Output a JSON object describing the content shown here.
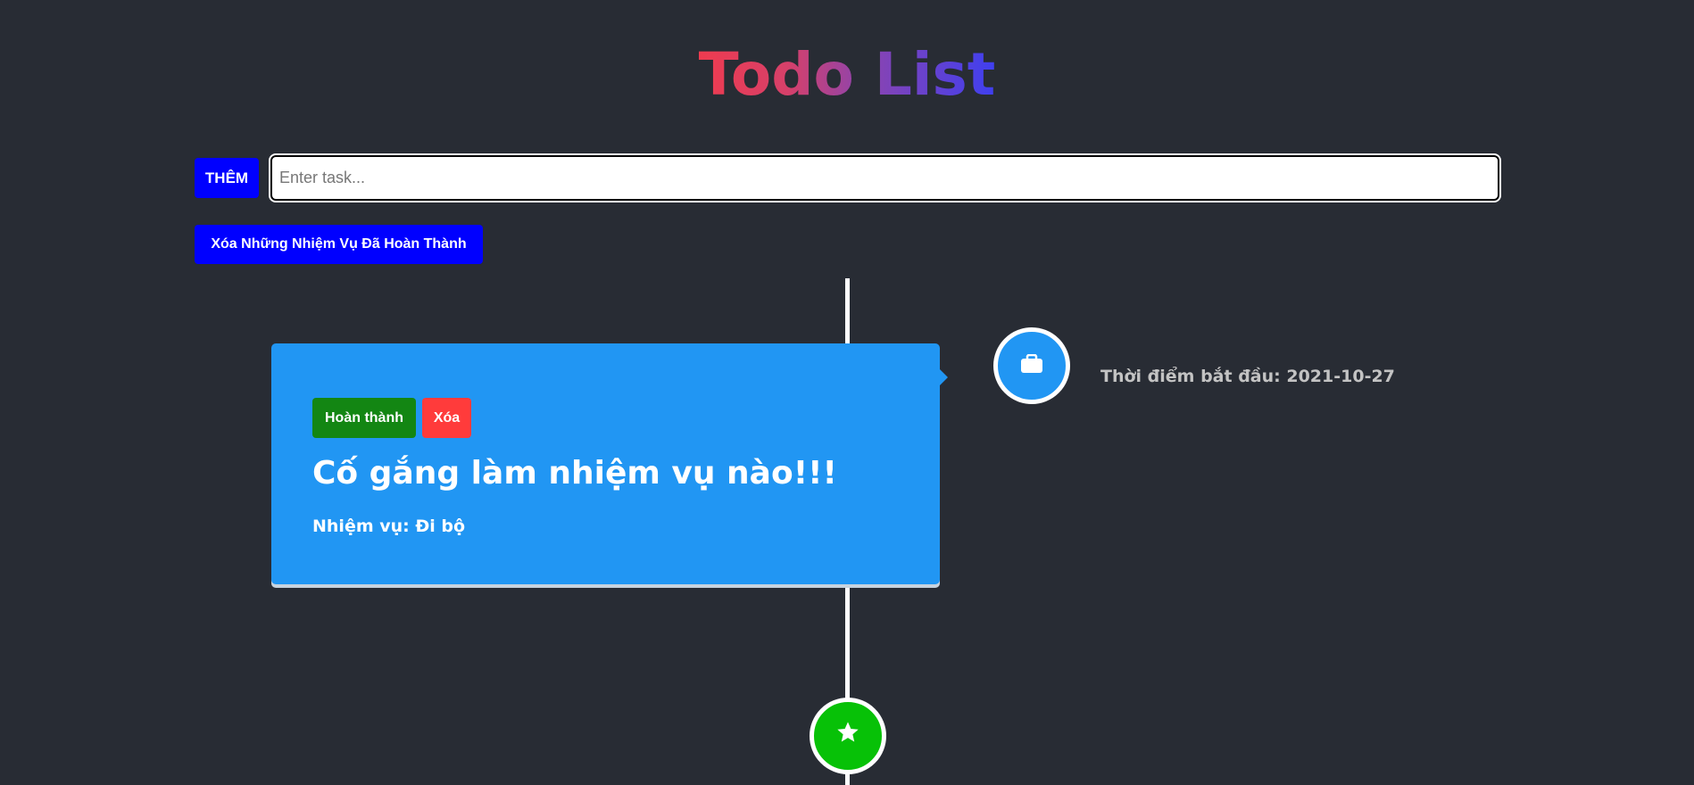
{
  "header": {
    "title": "Todo List"
  },
  "form": {
    "add_label": "THÊM",
    "input_placeholder": "Enter task...",
    "input_value": "",
    "clear_completed_label": "Xóa Những Nhiệm Vụ Đã Hoàn Thành"
  },
  "timeline": {
    "items": [
      {
        "icon": "briefcase-icon",
        "icon_bg": "#2196f3",
        "done_label": "Hoàn thành",
        "delete_label": "Xóa",
        "heading": "Cố gắng làm nhiệm vụ nào!!!",
        "task": "Nhiệm vụ: Đi bộ",
        "date": "Thời điểm bắt đầu: 2021-10-27"
      }
    ],
    "end_icon": "star-icon",
    "end_icon_bg": "#07c107"
  },
  "colors": {
    "background": "#282c34",
    "primary_button": "#0000ff",
    "card": "#2196f3",
    "done_button": "#138613",
    "delete_button": "#ff3b3b"
  }
}
